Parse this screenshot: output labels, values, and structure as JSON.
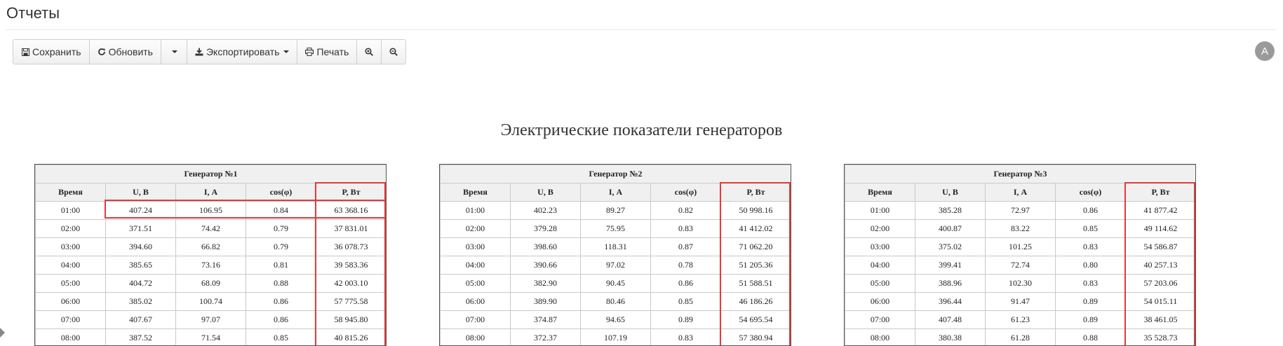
{
  "page": {
    "title": "Отчеты"
  },
  "toolbar": {
    "save_label": "Сохранить",
    "refresh_label": "Обновить",
    "export_label": "Экспортировать",
    "print_label": "Печать"
  },
  "user": {
    "avatar_letter": "A"
  },
  "report": {
    "title": "Электрические показатели генераторов",
    "columns": [
      "Время",
      "U, В",
      "I, А",
      "cos(φ)",
      "P, Вт"
    ],
    "generators": [
      {
        "name": "Генератор №1",
        "rows": [
          [
            "01:00",
            "407.24",
            "106.95",
            "0.84",
            "63 368.16"
          ],
          [
            "02:00",
            "371.51",
            "74.42",
            "0.79",
            "37 831.01"
          ],
          [
            "03:00",
            "394.60",
            "66.82",
            "0.79",
            "36 078.73"
          ],
          [
            "04:00",
            "385.65",
            "73.16",
            "0.81",
            "39 583.36"
          ],
          [
            "05:00",
            "404.72",
            "68.09",
            "0.88",
            "42 003.10"
          ],
          [
            "06:00",
            "385.02",
            "100.74",
            "0.86",
            "57 775.58"
          ],
          [
            "07:00",
            "407.67",
            "97.07",
            "0.86",
            "58 945.80"
          ],
          [
            "08:00",
            "387.52",
            "71.54",
            "0.85",
            "40 815.26"
          ]
        ]
      },
      {
        "name": "Генератор №2",
        "rows": [
          [
            "01:00",
            "402.23",
            "89.27",
            "0.82",
            "50 998.16"
          ],
          [
            "02:00",
            "379.28",
            "75.95",
            "0.83",
            "41 412.02"
          ],
          [
            "03:00",
            "398.60",
            "118.31",
            "0.87",
            "71 062.20"
          ],
          [
            "04:00",
            "390.66",
            "97.02",
            "0.78",
            "51 205.36"
          ],
          [
            "05:00",
            "382.90",
            "90.45",
            "0.86",
            "51 588.51"
          ],
          [
            "06:00",
            "389.90",
            "80.46",
            "0.85",
            "46 186.26"
          ],
          [
            "07:00",
            "374.87",
            "94.65",
            "0.89",
            "54 695.54"
          ],
          [
            "08:00",
            "372.37",
            "107.19",
            "0.83",
            "57 380.94"
          ]
        ]
      },
      {
        "name": "Генератор №3",
        "rows": [
          [
            "01:00",
            "385.28",
            "72.97",
            "0.86",
            "41 877.42"
          ],
          [
            "02:00",
            "400.87",
            "83.22",
            "0.85",
            "49 114.62"
          ],
          [
            "03:00",
            "375.02",
            "101.25",
            "0.83",
            "54 586.87"
          ],
          [
            "04:00",
            "399.41",
            "72.74",
            "0.80",
            "40 257.13"
          ],
          [
            "05:00",
            "388.96",
            "102.30",
            "0.83",
            "57 203.06"
          ],
          [
            "06:00",
            "396.44",
            "91.47",
            "0.89",
            "54 015.11"
          ],
          [
            "07:00",
            "407.48",
            "61.23",
            "0.89",
            "38 461.05"
          ],
          [
            "08:00",
            "380.38",
            "61.28",
            "0.88",
            "35 528.73"
          ]
        ]
      }
    ]
  },
  "colors": {
    "highlight": "#e23a3a",
    "header_bg": "#f0f0f0"
  }
}
